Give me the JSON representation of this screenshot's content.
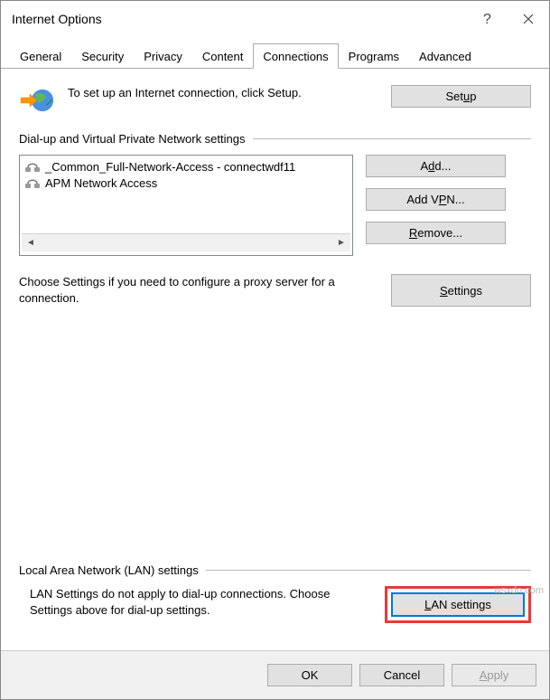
{
  "window": {
    "title": "Internet Options"
  },
  "tabs": [
    "General",
    "Security",
    "Privacy",
    "Content",
    "Connections",
    "Programs",
    "Advanced"
  ],
  "active_tab": "Connections",
  "setup": {
    "text": "To set up an Internet connection, click Setup.",
    "button": "Setup",
    "button_accel": "u"
  },
  "dialup": {
    "group": "Dial-up and Virtual Private Network settings",
    "items": [
      "_Common_Full-Network-Access - connectwdf11",
      "APM Network Access"
    ],
    "buttons": {
      "add": {
        "pre": "A",
        "accel": "d",
        "post": "d..."
      },
      "add_vpn": {
        "pre": "Add V",
        "accel": "P",
        "post": "N..."
      },
      "remove": {
        "pre": "",
        "accel": "R",
        "post": "emove..."
      },
      "settings": {
        "pre": "",
        "accel": "S",
        "post": "ettings"
      }
    },
    "settings_text": "Choose Settings if you need to configure a proxy server for a connection."
  },
  "lan": {
    "group": "Local Area Network (LAN) settings",
    "text": "LAN Settings do not apply to dial-up connections. Choose Settings above for dial-up settings.",
    "button": {
      "pre": "",
      "accel": "L",
      "post": "AN settings"
    }
  },
  "footer": {
    "ok": "OK",
    "cancel": "Cancel",
    "apply": {
      "pre": "",
      "accel": "A",
      "post": "pply"
    }
  },
  "watermark": "wsxdn.com"
}
